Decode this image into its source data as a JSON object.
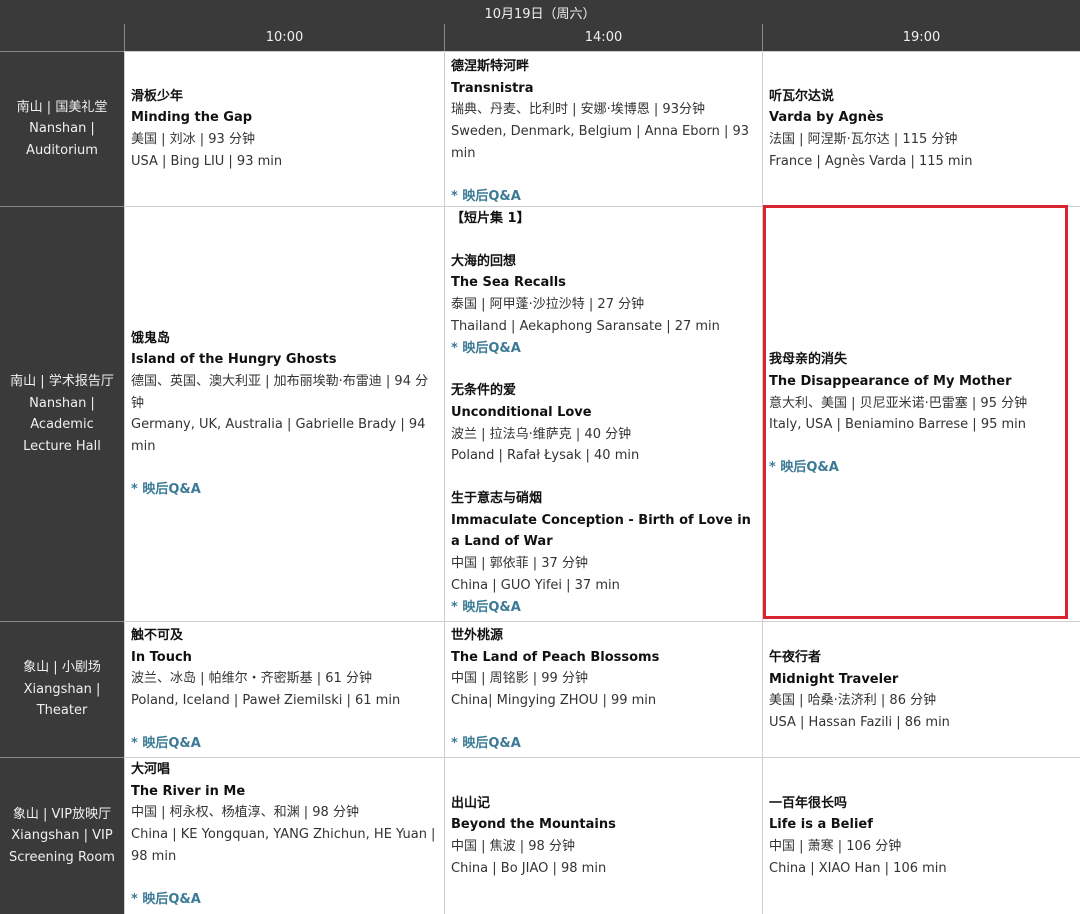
{
  "date": "10月19日（周六）",
  "times": [
    "10:00",
    "14:00",
    "19:00"
  ],
  "venues": [
    {
      "zh": "南山 | 国美礼堂",
      "en1": "Nanshan |",
      "en2": "Auditorium",
      "en3": ""
    },
    {
      "zh": "南山 | 学术报告厅",
      "en1": "Nanshan |",
      "en2": "Academic",
      "en3": "Lecture Hall"
    },
    {
      "zh": "象山 | 小剧场",
      "en1": "Xiangshan |",
      "en2": "Theater",
      "en3": ""
    },
    {
      "zh": "象山 | VIP放映厅",
      "en1": "Xiangshan | VIP",
      "en2": "Screening Room",
      "en3": ""
    }
  ],
  "qa_label": "* 映后Q&A",
  "shorts_label": "【短片集 1】",
  "r0": {
    "c0": {
      "zh": "滑板少年",
      "en": "Minding the Gap",
      "info_zh": "美国 | 刘冰 | 93 分钟",
      "info_en": "USA | Bing LIU | 93 min"
    },
    "c1": {
      "zh": "德涅斯特河畔",
      "en": "Transnistra",
      "info_zh": "瑞典、丹麦、比利时 | 安娜·埃博恩 | 93分钟",
      "info_en": "Sweden, Denmark, Belgium | Anna Eborn | 93 min"
    },
    "c2": {
      "zh": "听瓦尔达说",
      "en": "Varda by Agnès",
      "info_zh": "法国 | 阿涅斯·瓦尔达 | 115 分钟",
      "info_en": "France | Agnès Varda | 115 min"
    }
  },
  "r1": {
    "c0": {
      "zh": "饿鬼岛",
      "en": "Island of the Hungry Ghosts",
      "info_zh": "德国、英国、澳大利亚 | 加布丽埃勒·布雷迪 | 94 分钟",
      "info_en": "Germany, UK, Australia |  Gabrielle Brady | 94 min"
    },
    "c1a": {
      "zh": "大海的回想",
      "en": "The Sea Recalls",
      "info_zh": "泰国 | 阿甲蓬·沙拉沙特 | 27 分钟",
      "info_en": "Thailand | Aekaphong Saransate | 27 min"
    },
    "c1b": {
      "zh": "无条件的爱",
      "en": "Unconditional Love",
      "info_zh": "波兰 | 拉法乌·维萨克 | 40 分钟",
      "info_en": "Poland | Rafał Łysak | 40 min"
    },
    "c1c": {
      "zh": "生于意志与硝烟",
      "en": "Immaculate Conception - Birth of Love in a Land of War",
      "info_zh": "中国 | 郭依菲 | 37 分钟",
      "info_en": "China | GUO Yifei | 37 min"
    },
    "c2": {
      "zh": "我母亲的消失",
      "en": "The Disappearance of My Mother",
      "info_zh": "意大利、美国 | 贝尼亚米诺·巴雷塞 | 95 分钟",
      "info_en": "Italy, USA | Beniamino Barrese | 95 min"
    }
  },
  "r2": {
    "c0": {
      "zh": "触不可及",
      "en": "In Touch",
      "info_zh": "波兰、冰岛 | 帕维尔・齐密斯基 | 61 分钟",
      "info_en": "Poland, Iceland | Paweł Ziemilski | 61 min"
    },
    "c1": {
      "zh": "世外桃源",
      "en": "The Land of Peach Blossoms",
      "info_zh": "中国 | 周铭影 | 99 分钟",
      "info_en": "China| Mingying ZHOU | 99 min"
    },
    "c2": {
      "zh": "午夜行者",
      "en": "Midnight Traveler",
      "info_zh": "美国 | 哈桑·法济利 | 86 分钟",
      "info_en": "USA | Hassan Fazili | 86 min"
    }
  },
  "r3": {
    "c0": {
      "zh": "大河唱",
      "en": "The River in Me",
      "info_zh": "中国 | 柯永权、杨植淳、和渊 | 98 分钟",
      "info_en": "China | KE  Yongquan, YANG Zhichun, HE  Yuan | 98 min"
    },
    "c1": {
      "zh": "出山记",
      "en": "Beyond the Mountains",
      "info_zh": "中国 | 焦波 |  98 分钟",
      "info_en": "China | Bo JIAO | 98 min"
    },
    "c2": {
      "zh": "一百年很长吗",
      "en": "Life is a Belief",
      "info_zh": "中国 | 萧寒 | 106 分钟",
      "info_en": "China | XIAO Han | 106 min"
    }
  }
}
